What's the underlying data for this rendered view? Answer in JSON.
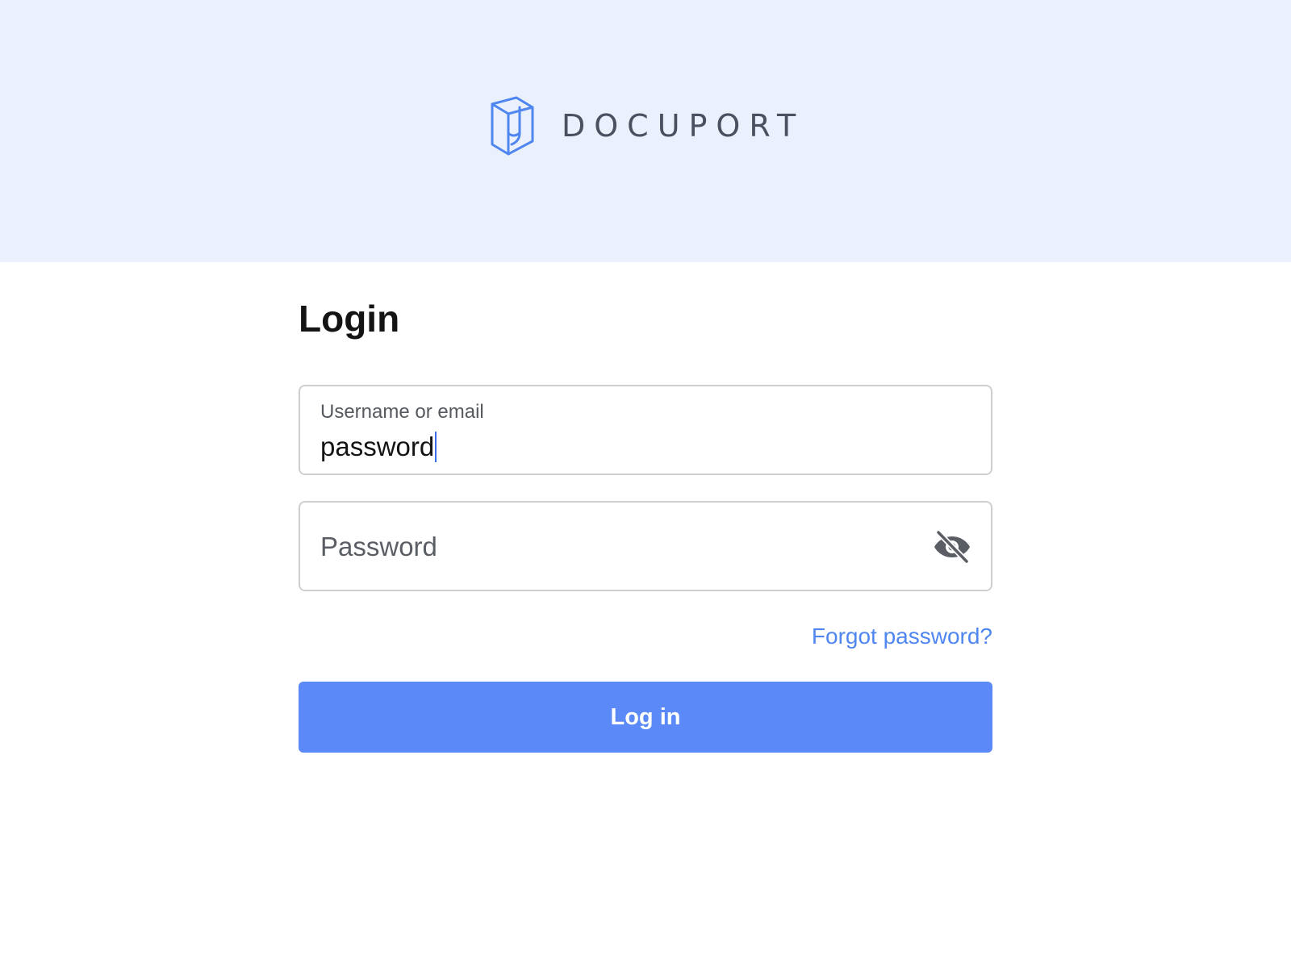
{
  "brand": {
    "name": "DOCUPORT",
    "logo_icon": "docuport-logo-icon",
    "color": "#4f86f0"
  },
  "header": {
    "background": "#eaf1fd"
  },
  "login": {
    "title": "Login",
    "username_field": {
      "label": "Username or email",
      "value": "password"
    },
    "password_field": {
      "placeholder": "Password",
      "value": "",
      "toggle_icon": "eye-off-icon"
    },
    "forgot_password_label": "Forgot password?",
    "submit_label": "Log in",
    "accent_color": "#5b89f7"
  }
}
